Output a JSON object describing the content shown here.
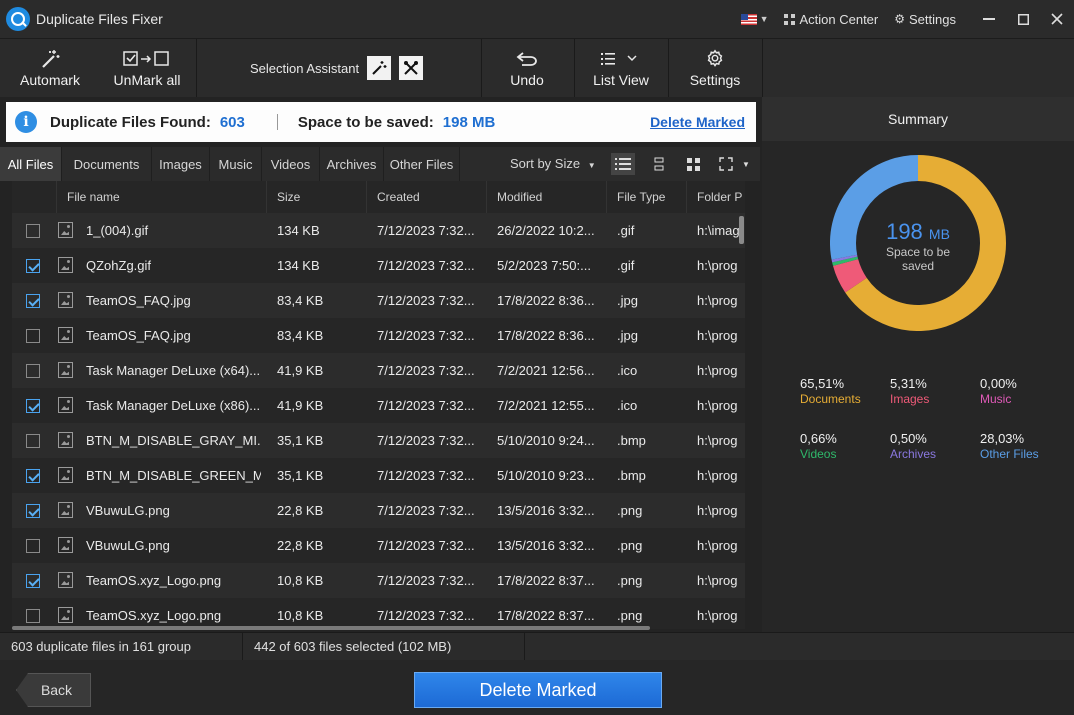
{
  "window": {
    "title": "Duplicate Files Fixer",
    "action_center": "Action Center",
    "settings": "Settings"
  },
  "toolbar": {
    "automark": "Automark",
    "unmark_all": "UnMark all",
    "selection_assistant": "Selection Assistant",
    "undo": "Undo",
    "list_view": "List View",
    "settings": "Settings"
  },
  "info": {
    "found_label": "Duplicate Files Found:",
    "found_value": "603",
    "space_label": "Space to be saved:",
    "space_value": "198 MB",
    "delete_link": "Delete Marked"
  },
  "tabs": [
    "All Files",
    "Documents",
    "Images",
    "Music",
    "Videos",
    "Archives",
    "Other Files"
  ],
  "active_tab": 0,
  "sort_label": "Sort by Size",
  "columns": [
    "File name",
    "Size",
    "Created",
    "Modified",
    "File Type",
    "Folder P"
  ],
  "rows": [
    {
      "checked": false,
      "name": "1_(004).gif",
      "size": "134 KB",
      "created": "7/12/2023 7:32...",
      "modified": "26/2/2022 10:2...",
      "type": ".gif",
      "folder": "h:\\imag"
    },
    {
      "checked": true,
      "name": "QZohZg.gif",
      "size": "134 KB",
      "created": "7/12/2023 7:32...",
      "modified": "5/2/2023 7:50:...",
      "type": ".gif",
      "folder": "h:\\prog"
    },
    {
      "checked": true,
      "name": "TeamOS_FAQ.jpg",
      "size": "83,4 KB",
      "created": "7/12/2023 7:32...",
      "modified": "17/8/2022 8:36...",
      "type": ".jpg",
      "folder": "h:\\prog"
    },
    {
      "checked": false,
      "name": "TeamOS_FAQ.jpg",
      "size": "83,4 KB",
      "created": "7/12/2023 7:32...",
      "modified": "17/8/2022 8:36...",
      "type": ".jpg",
      "folder": "h:\\prog"
    },
    {
      "checked": false,
      "name": "Task Manager DeLuxe (x64)...",
      "size": "41,9 KB",
      "created": "7/12/2023 7:32...",
      "modified": "7/2/2021 12:56...",
      "type": ".ico",
      "folder": "h:\\prog"
    },
    {
      "checked": true,
      "name": "Task Manager DeLuxe (x86)...",
      "size": "41,9 KB",
      "created": "7/12/2023 7:32...",
      "modified": "7/2/2021 12:55...",
      "type": ".ico",
      "folder": "h:\\prog"
    },
    {
      "checked": false,
      "name": "BTN_M_DISABLE_GRAY_MI...",
      "size": "35,1 KB",
      "created": "7/12/2023 7:32...",
      "modified": "5/10/2010 9:24...",
      "type": ".bmp",
      "folder": "h:\\prog"
    },
    {
      "checked": true,
      "name": "BTN_M_DISABLE_GREEN_M...",
      "size": "35,1 KB",
      "created": "7/12/2023 7:32...",
      "modified": "5/10/2010 9:23...",
      "type": ".bmp",
      "folder": "h:\\prog"
    },
    {
      "checked": true,
      "name": "VBuwuLG.png",
      "size": "22,8 KB",
      "created": "7/12/2023 7:32...",
      "modified": "13/5/2016 3:32...",
      "type": ".png",
      "folder": "h:\\prog"
    },
    {
      "checked": false,
      "name": "VBuwuLG.png",
      "size": "22,8 KB",
      "created": "7/12/2023 7:32...",
      "modified": "13/5/2016 3:32...",
      "type": ".png",
      "folder": "h:\\prog"
    },
    {
      "checked": true,
      "name": "TeamOS.xyz_Logo.png",
      "size": "10,8 KB",
      "created": "7/12/2023 7:32...",
      "modified": "17/8/2022 8:37...",
      "type": ".png",
      "folder": "h:\\prog"
    },
    {
      "checked": false,
      "name": "TeamOS.xyz_Logo.png",
      "size": "10,8 KB",
      "created": "7/12/2023 7:32...",
      "modified": "17/8/2022 8:37...",
      "type": ".png",
      "folder": "h:\\prog"
    }
  ],
  "summary": {
    "title": "Summary",
    "total_number": "198",
    "total_unit": "MB",
    "sub_text": "Space to be saved",
    "stats": [
      {
        "pct": "65,51%",
        "name": "Documents",
        "color": "#e6ad35",
        "value": 65.51
      },
      {
        "pct": "5,31%",
        "name": "Images",
        "color": "#ef5a78",
        "value": 5.31
      },
      {
        "pct": "0,00%",
        "name": "Music",
        "color": "#e05ab8",
        "value": 0.0
      },
      {
        "pct": "0,66%",
        "name": "Videos",
        "color": "#2fb86a",
        "value": 0.66
      },
      {
        "pct": "0,50%",
        "name": "Archives",
        "color": "#8a78e0",
        "value": 0.5
      },
      {
        "pct": "28,03%",
        "name": "Other Files",
        "color": "#5b9ee6",
        "value": 28.03
      }
    ]
  },
  "status": {
    "groups": "603 duplicate files in 161 group",
    "selected": "442 of 603 files selected  (102 MB)"
  },
  "bottom": {
    "back": "Back",
    "delete": "Delete Marked"
  }
}
